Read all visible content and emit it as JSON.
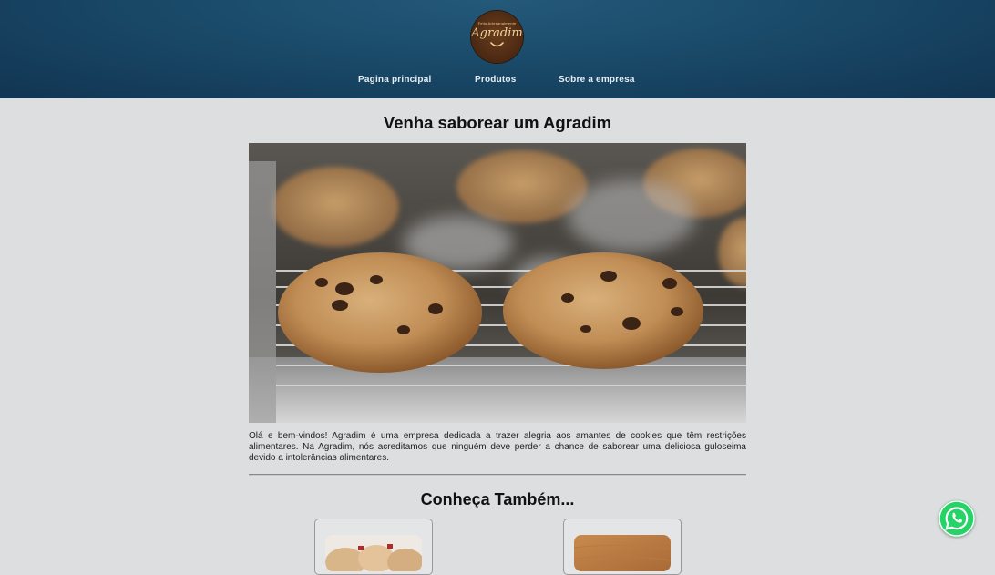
{
  "header": {
    "logo": {
      "tagline": "Feito Artesanalmente",
      "brand": "Agradim"
    },
    "nav": [
      {
        "label": "Pagina principal"
      },
      {
        "label": "Produtos"
      },
      {
        "label": "Sobre a empresa"
      }
    ],
    "background_color": "#1a4a69"
  },
  "main": {
    "title": "Venha saborear um Agradim",
    "hero_image": "cookies-on-cooling-rack",
    "intro": "Olá e bem-vindos! Agradim é uma empresa dedicada a trazer alegria aos amantes de cookies que têm restrições alimentares. Na Agradim, nós acreditamos que ninguém deve perder a chance de saborear uma deliciosa guloseima devido a intolerâncias alimentares.",
    "section_title": "Conheça Também...",
    "cards": [
      {
        "image": "cookie-bags-photo"
      },
      {
        "image": "wooden-board-photo"
      }
    ]
  },
  "floating": {
    "whatsapp_icon": "whatsapp-icon",
    "whatsapp_color": "#25d366"
  },
  "colors": {
    "page_background": "#dcdedf",
    "text": "#111111"
  }
}
